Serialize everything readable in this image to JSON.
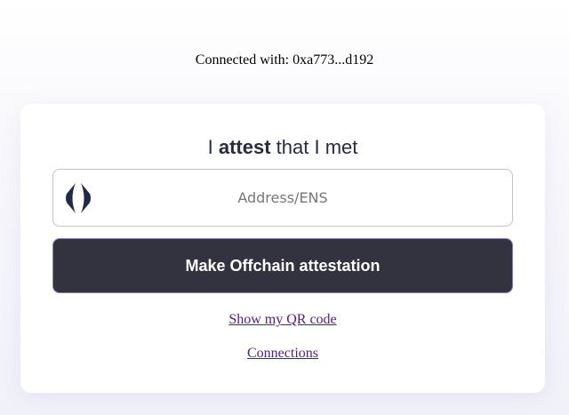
{
  "header": {
    "connected_text": "Connected with: 0xa773...d192"
  },
  "card": {
    "heading_prefix": "I ",
    "heading_bold": "attest",
    "heading_suffix": " that I met",
    "address_input": {
      "placeholder": "Address/ENS",
      "value": "",
      "icon": "ens-logo-icon"
    },
    "attest_button_label": "Make Offchain attestation",
    "qr_link_label": "Show my QR code",
    "connections_link_label": "Connections"
  },
  "colors": {
    "button_bg": "#33323f",
    "button_border": "#8a7fc8",
    "heading_text": "#272c3f",
    "link": "#551a8b"
  }
}
